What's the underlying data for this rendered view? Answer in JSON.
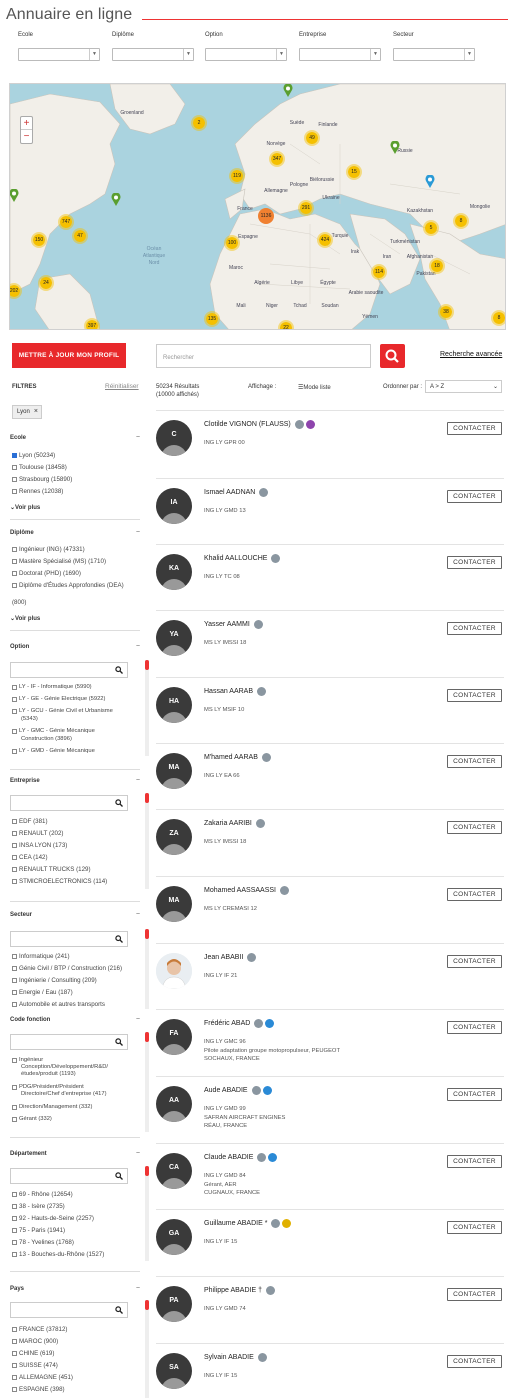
{
  "page": {
    "title": "Annuaire en ligne"
  },
  "filters_top": [
    {
      "label": "Ecole"
    },
    {
      "label": "Diplôme"
    },
    {
      "label": "Option"
    },
    {
      "label": "Entreprise"
    },
    {
      "label": "Secteur"
    }
  ],
  "map": {
    "zoom_in": "+",
    "zoom_out": "−",
    "labels": {
      "groenland": "Groenland",
      "ocean": "Océan",
      "atlantique": "Atlantique",
      "nord": "Nord",
      "norvege": "Norvège",
      "suede": "Suède",
      "finlande": "Finlande",
      "russie": "Russie",
      "kazakhstan": "Kazakhstan",
      "allemagne": "Allemagne",
      "france": "France",
      "espagne": "Espagne",
      "maroc": "Maroc",
      "algerie": "Algérie",
      "libye": "Libye",
      "egypte": "Égypte",
      "mali": "Mali",
      "niger": "Niger",
      "tchad": "Tchad",
      "soudan": "Soudan",
      "arabie": "Arabie saoudite",
      "iran": "Iran",
      "turkmenistan": "Turkménistan",
      "afghanistan": "Afghanistan",
      "pakistan": "Pakistan",
      "ukraine": "Ukraine",
      "bielorussie": "Biélorussie",
      "pologne": "Pologne",
      "turquie": "Turquie",
      "irak": "Irak",
      "yemen": "Yémen",
      "mongolie": "Mongolie"
    },
    "clusters": [
      "2",
      "49",
      "347",
      "119",
      "15",
      "291",
      "8",
      "5",
      "424",
      "100",
      "114",
      "18",
      "38",
      "8",
      "135",
      "1136",
      "747",
      "150",
      "47",
      "24",
      "202",
      "397",
      "22"
    ]
  },
  "actions": {
    "update_profile": "METTRE À JOUR MON PROFIL",
    "search_placeholder": "Rechercher",
    "advanced_search": "Recherche avancée"
  },
  "list_header": {
    "filters_title": "FILTRES",
    "reset": "Réinitialiser",
    "results_line1": "50234 Résultats",
    "results_line2": "(10000 affichés)",
    "display_label": "Affichage :",
    "mode": "Mode liste",
    "order_label": "Ordonner par :",
    "order_value": "A > Z"
  },
  "active_chip": "Lyon",
  "sidebar": {
    "ecole": {
      "title": "Ecole",
      "items": [
        "Lyon (50234)",
        "Toulouse (18458)",
        "Strasbourg (15890)",
        "Rennes (12038)"
      ],
      "more": "Voir plus"
    },
    "diplome": {
      "title": "Diplôme",
      "items": [
        "Ingénieur (ING) (47331)",
        "Mastère Spécialisé (MS) (1710)",
        "Doctorat (PHD) (1690)",
        "Diplôme d'Études Approfondies (DEA)",
        "(800)"
      ],
      "more": "Voir plus"
    },
    "option": {
      "title": "Option",
      "items": [
        "LY - IF - Informatique (5990)",
        "LY - GE - Génie Electrique (5922)",
        "LY - GCU - Génie Civil et Urbanisme",
        "(5343)",
        "LY - GMC - Génie Mécanique",
        "Construction (3896)",
        "LY - GMD - Génie Mécanique"
      ]
    },
    "entreprise": {
      "title": "Entreprise",
      "items": [
        "EDF (381)",
        "RENAULT (202)",
        "INSA LYON (173)",
        "CEA (142)",
        "RENAULT TRUCKS (129)",
        "STMICROELECTRONICS (114)"
      ]
    },
    "secteur": {
      "title": "Secteur",
      "items": [
        "Informatique (241)",
        "Génie Civil / BTP / Construction (216)",
        "Ingénierie / Consulting (209)",
        "Energie / Eau (187)",
        "Automobile et autres transports"
      ]
    },
    "code_fonction": {
      "title": "Code fonction",
      "items": [
        "Ingénieur",
        "Conception/Développement/R&D/",
        "études/produit (1193)",
        "PDG/Président/Président",
        "Directoire/Chef d'entreprise (417)",
        "Direction/Management (332)",
        "Gérant (332)"
      ]
    },
    "departement": {
      "title": "Département",
      "items": [
        "69 - Rhône (12654)",
        "38 - Isère (2735)",
        "92 - Hauts-de-Seine (2257)",
        "75 - Paris (1941)",
        "78 - Yvelines (1768)",
        "13 - Bouches-du-Rhône (1527)"
      ]
    },
    "pays": {
      "title": "Pays",
      "items": [
        "FRANCE (37812)",
        "MAROC (900)",
        "CHINE (619)",
        "SUISSE (474)",
        "ALLEMAGNE (451)",
        "ESPAGNE (398)"
      ]
    }
  },
  "contact_label": "CONTACTER",
  "people": [
    {
      "initials": "C",
      "name": "Clotilde VIGNON (FLAUSS)",
      "lines": [
        "ING LY GPR 00"
      ],
      "extra_icon": "purple"
    },
    {
      "initials": "IA",
      "name": "Ismael AADNAN",
      "lines": [
        "ING LY GMD 13"
      ]
    },
    {
      "initials": "KA",
      "name": "Khalid AALLOUCHE",
      "lines": [
        "ING LY TC 08"
      ]
    },
    {
      "initials": "YA",
      "name": "Yasser AAMMI",
      "lines": [
        "MS LY IMSSI 18"
      ]
    },
    {
      "initials": "HA",
      "name": "Hassan AARAB",
      "lines": [
        "MS LY MSIF 10"
      ]
    },
    {
      "initials": "MA",
      "name": "M'hamed AARAB",
      "lines": [
        "ING LY EA 66"
      ]
    },
    {
      "initials": "ZA",
      "name": "Zakaria AARIBI",
      "lines": [
        "MS LY IMSSI 18"
      ]
    },
    {
      "initials": "MA",
      "name": "Mohamed AASSAASSI",
      "lines": [
        "MS LY CREMASI 12"
      ]
    },
    {
      "initials": "",
      "name": "Jean ABABII",
      "lines": [
        "ING LY IF 21"
      ],
      "photo": true
    },
    {
      "initials": "FA",
      "name": "Frédéric ABAD",
      "lines": [
        "ING LY GMC 96",
        "Pilote adaptation groupe motopropulseur, PEUGEOT",
        "SOCHAUX, FRANCE"
      ],
      "extra_icon": "blue"
    },
    {
      "initials": "AA",
      "name": "Aude ABADIE",
      "lines": [
        "ING LY GMD 99",
        "SAFRAN AIRCRAFT ENGINES",
        "RÉAU, FRANCE"
      ],
      "extra_icon": "blue"
    },
    {
      "initials": "CA",
      "name": "Claude ABADIE",
      "lines": [
        "ING LY GMD 84",
        "Gérant, AER",
        "CUGNAUX, FRANCE"
      ],
      "extra_icon": "blue"
    },
    {
      "initials": "GA",
      "name": "Guillaume ABADIE *",
      "lines": [
        "ING LY IF 15"
      ],
      "extra_icon": "gold"
    },
    {
      "initials": "PA",
      "name": "Philippe ABADIE †",
      "lines": [
        "ING LY GMD 74"
      ]
    },
    {
      "initials": "SA",
      "name": "Sylvain ABADIE",
      "lines": [
        "ING LY IF 15"
      ]
    }
  ]
}
